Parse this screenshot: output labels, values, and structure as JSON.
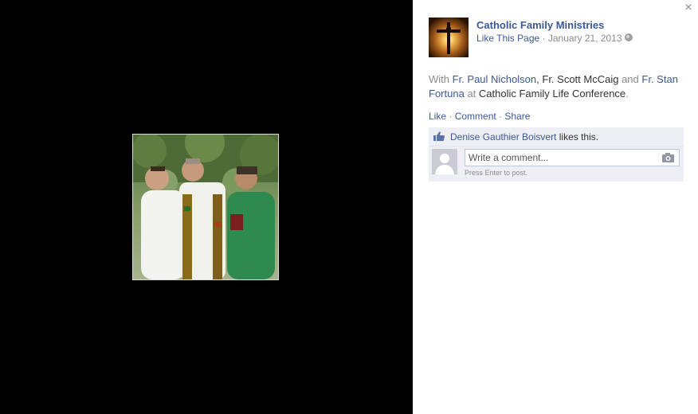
{
  "photo": {
    "alt": "Three priests in vestments talking outdoors"
  },
  "panel": {
    "close_glyph": "×",
    "page_name": "Catholic Family Ministries",
    "like_page": "Like This Page",
    "separator": " · ",
    "date": "January 21, 2013",
    "privacy_icon": "globe-icon",
    "caption": {
      "with": "With",
      "person1": "Fr. Paul Nicholson",
      "comma1": ",",
      "person2": "Fr. Scott McCaig",
      "and": "and",
      "person3": "Fr. Stan Fortuna",
      "at": "at",
      "place": "Catholic Family Life Conference",
      "period": "."
    },
    "actions": {
      "like": "Like",
      "comment": "Comment",
      "share": "Share",
      "sep": " · "
    },
    "likes": {
      "name": "Denise Gauthier Boisvert",
      "suffix": " likes this."
    },
    "comment": {
      "placeholder": "Write a comment...",
      "hint": "Press Enter to post.",
      "camera_icon": "camera-icon"
    }
  },
  "colors": {
    "link": "#3b5998",
    "muted": "#8b8b8b",
    "ufi_bg": "#edeff4",
    "stage": "#000000"
  }
}
